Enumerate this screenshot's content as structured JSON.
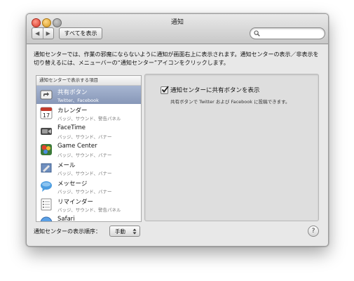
{
  "window": {
    "title": "通知"
  },
  "toolbar": {
    "back_label": "◀",
    "forward_label": "▶",
    "show_all_label": "すべてを表示",
    "search_placeholder": ""
  },
  "description": "通知センターでは、作業の邪魔にならないように通知が画面右上に表示されます。通知センターの表示／非表示を切り替えるには、メニューバーの“通知センター”アイコンをクリックします。",
  "list": {
    "header": "通知センターで表示する項目",
    "items": [
      {
        "name": "共有ボタン",
        "subtitle": "Twitter、Facebook",
        "icon": "share-icon",
        "selected": true
      },
      {
        "name": "カレンダー",
        "subtitle": "バッジ、サウンド、警告パネル",
        "icon": "calendar-icon",
        "calendar_day": "17"
      },
      {
        "name": "FaceTime",
        "subtitle": "バッジ、サウンド、バナー",
        "icon": "facetime-icon"
      },
      {
        "name": "Game Center",
        "subtitle": "バッジ、サウンド、バナー",
        "icon": "game-center-icon"
      },
      {
        "name": "メール",
        "subtitle": "バッジ、サウンド、バナー",
        "icon": "mail-icon"
      },
      {
        "name": "メッセージ",
        "subtitle": "バッジ、サウンド、バナー",
        "icon": "messages-icon"
      },
      {
        "name": "リマインダー",
        "subtitle": "バッジ、サウンド、警告パネル",
        "icon": "reminders-icon"
      },
      {
        "name": "Safari",
        "subtitle": "",
        "icon": "safari-icon"
      }
    ]
  },
  "detail": {
    "checkbox_label": "通知センターに共有ボタンを表示",
    "checked": true,
    "checkbox_description": "共有ボタンで Twitter および Facebook に投稿できます。"
  },
  "footer": {
    "sort_label": "通知センターの表示順序：",
    "sort_value": "手動",
    "help_label": "?"
  },
  "colors": {
    "selection": "#8f9fc0",
    "panel": "#dedede"
  }
}
